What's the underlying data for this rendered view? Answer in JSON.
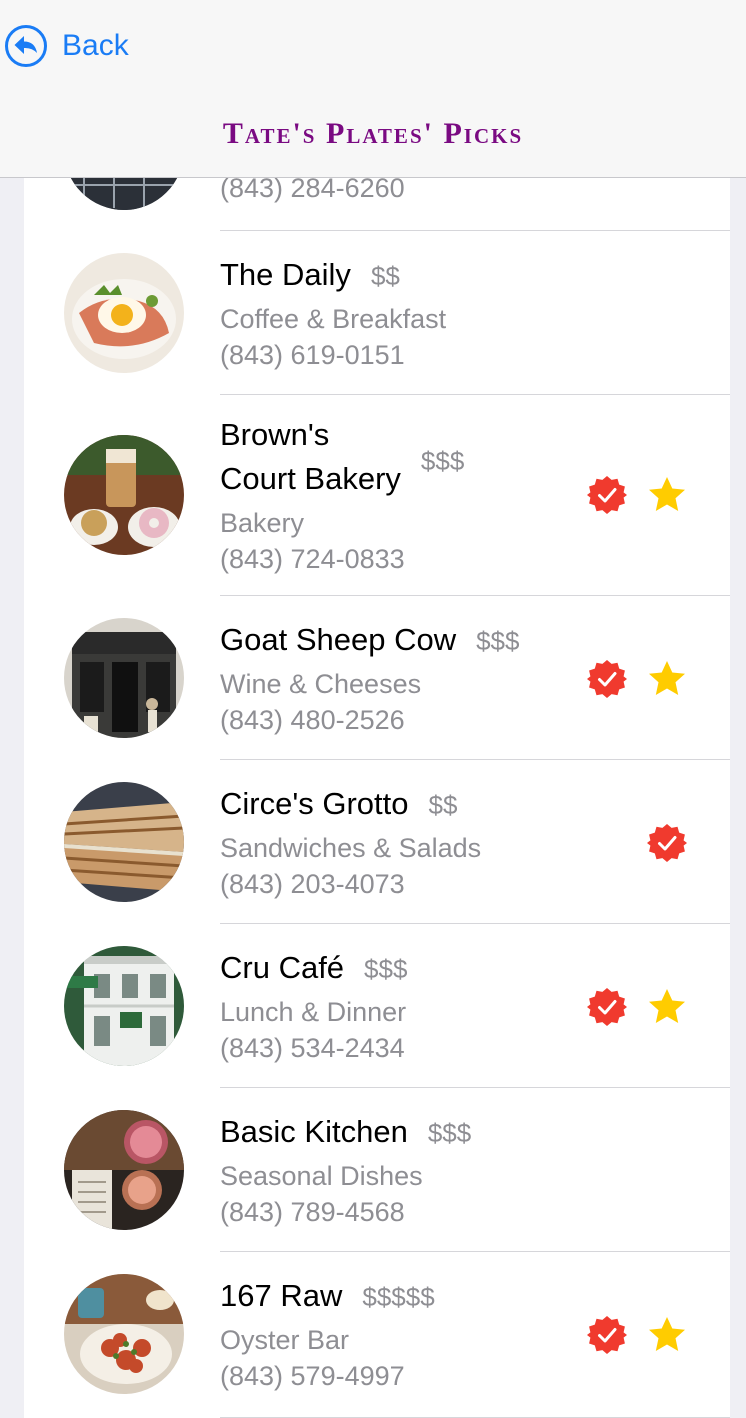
{
  "header": {
    "back_label": "Back",
    "title": "Tate's Plates' Picks"
  },
  "colors": {
    "accent": "#1a7cf5",
    "title": "#7a0a82",
    "badge": "#f03a2e",
    "star": "#ffcc00",
    "secondary_text": "#8e8e93"
  },
  "restaurants": [
    {
      "name": "",
      "price": "",
      "category": "",
      "phone": "(843) 284-6260",
      "verified": false,
      "starred": false
    },
    {
      "name": "The Daily",
      "price": "$$",
      "category": "Coffee & Breakfast",
      "phone": "(843)  619-0151",
      "verified": false,
      "starred": false
    },
    {
      "name": "Brown's",
      "name_line2": "Court Bakery",
      "price": "$$$",
      "category": "Bakery",
      "phone": "(843) 724-0833",
      "verified": true,
      "starred": true
    },
    {
      "name": "Goat Sheep Cow",
      "price": "$$$",
      "category": "Wine & Cheeses",
      "phone": "(843) 480-2526",
      "verified": true,
      "starred": true
    },
    {
      "name": "Circe's Grotto",
      "price": "$$",
      "category": "Sandwiches & Salads",
      "phone": "(843) 203-4073",
      "verified": true,
      "starred": false
    },
    {
      "name": "Cru Café",
      "price": "$$$",
      "category": "Lunch & Dinner",
      "phone": "(843) 534-2434",
      "verified": true,
      "starred": true
    },
    {
      "name": "Basic Kitchen",
      "price": "$$$",
      "category": "Seasonal Dishes",
      "phone": "(843) 789-4568",
      "verified": false,
      "starred": false
    },
    {
      "name": "167 Raw",
      "price": "$$$$$",
      "category": "Oyster Bar",
      "phone": "(843) 579-4997",
      "verified": true,
      "starred": true
    }
  ],
  "icons": {
    "back": "back-arrow-circle-icon",
    "verified": "verified-badge-icon",
    "favorite": "star-icon"
  }
}
